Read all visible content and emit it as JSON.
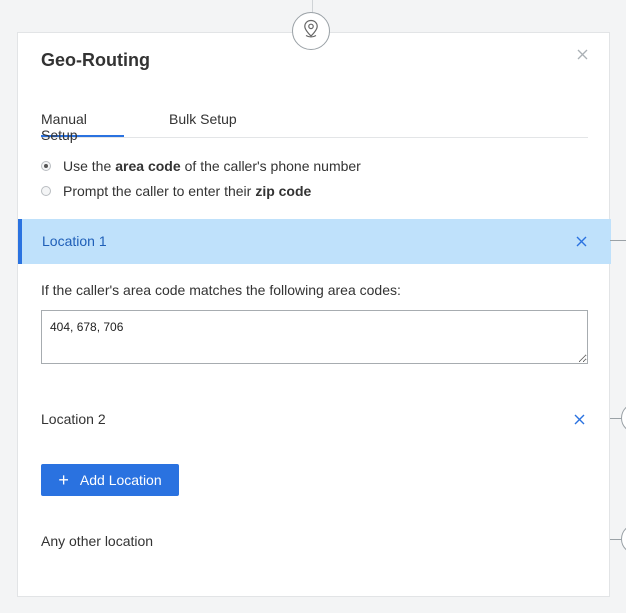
{
  "dialog": {
    "title": "Geo-Routing",
    "close_icon": "close-icon",
    "node_icon": "location-pin-icon"
  },
  "tabs": [
    {
      "label": "Manual Setup",
      "active": true
    },
    {
      "label": "Bulk Setup",
      "active": false
    }
  ],
  "routing_options": [
    {
      "prefix": "Use the",
      "bold": "area code",
      "suffix": "of the caller's phone number",
      "selected": true
    },
    {
      "prefix": "Prompt the caller to enter their",
      "bold": "zip code",
      "suffix": "",
      "selected": false
    }
  ],
  "locations": [
    {
      "label": "Location 1",
      "expanded": true,
      "remove_icon": "close-icon",
      "description": "If the caller's area code matches the following area codes:",
      "area_codes": "404, 678, 706"
    },
    {
      "label": "Location 2",
      "expanded": false,
      "remove_icon": "close-icon"
    }
  ],
  "add_location": {
    "label": "Add Location",
    "icon": "plus-icon"
  },
  "fallback": {
    "label": "Any other location"
  },
  "colors": {
    "accent": "#2a72e0",
    "active_row_bg": "#bfe1fb",
    "active_row_text": "#1f5fb8"
  }
}
